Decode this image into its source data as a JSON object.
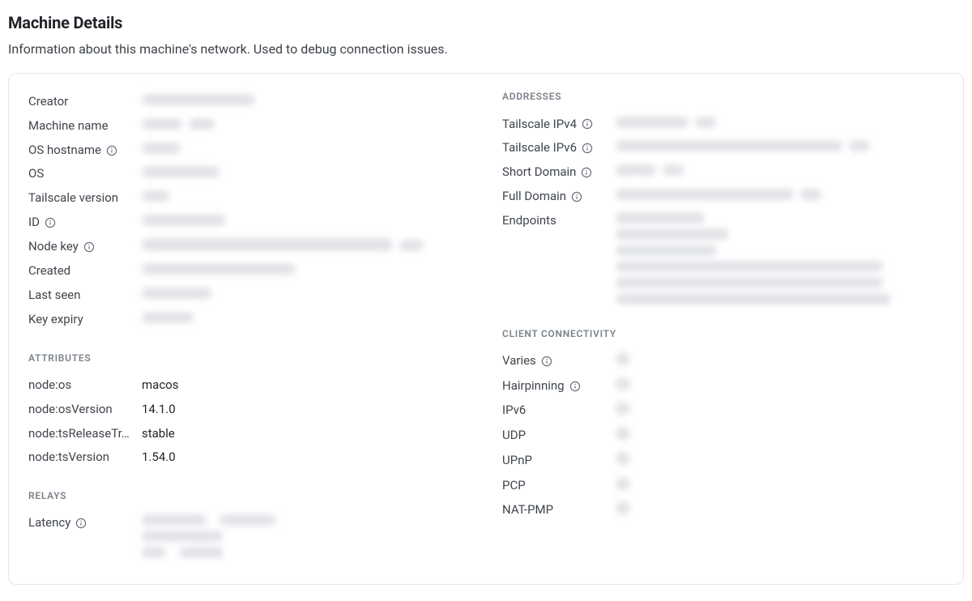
{
  "header": {
    "title": "Machine Details",
    "subtitle": "Information about this machine's network. Used to debug connection issues."
  },
  "left": {
    "basic": {
      "creator": "Creator",
      "machine_name": "Machine name",
      "os_hostname": "OS hostname",
      "os": "OS",
      "tailscale_version": "Tailscale version",
      "id": "ID",
      "node_key": "Node key",
      "created": "Created",
      "last_seen": "Last seen",
      "key_expiry": "Key expiry"
    },
    "attributes_head": "ATTRIBUTES",
    "attributes": {
      "node_os": {
        "label": "node:os",
        "value": "macos"
      },
      "node_os_version": {
        "label": "node:osVersion",
        "value": "14.1.0"
      },
      "node_ts_release_track": {
        "label": "node:tsReleaseTr…",
        "value": "stable"
      },
      "node_ts_version": {
        "label": "node:tsVersion",
        "value": "1.54.0"
      }
    },
    "relays_head": "RELAYS",
    "relays": {
      "latency": "Latency"
    }
  },
  "right": {
    "addresses_head": "ADDRESSES",
    "addresses": {
      "tailscale_ipv4": "Tailscale IPv4",
      "tailscale_ipv6": "Tailscale IPv6",
      "short_domain": "Short Domain",
      "full_domain": "Full Domain",
      "endpoints": "Endpoints"
    },
    "client_conn_head": "CLIENT CONNECTIVITY",
    "client_conn": {
      "varies": "Varies",
      "hairpinning": "Hairpinning",
      "ipv6": "IPv6",
      "udp": "UDP",
      "upnp": "UPnP",
      "pcp": "PCP",
      "nat_pmp": "NAT-PMP"
    }
  }
}
